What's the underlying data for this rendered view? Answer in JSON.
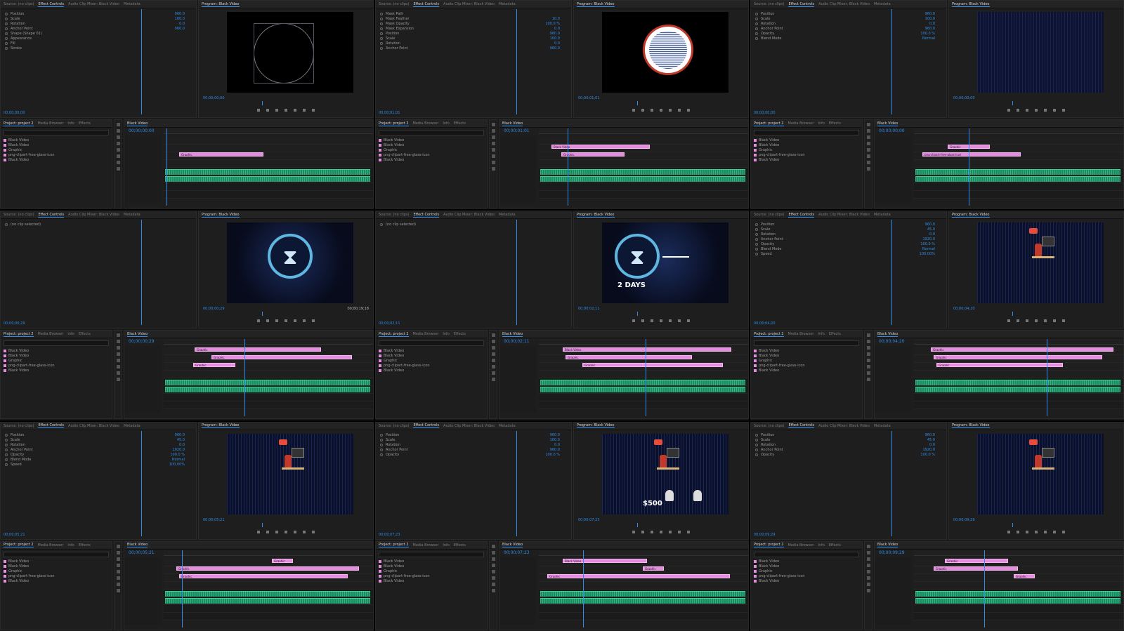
{
  "common": {
    "source_tabs": [
      "Source: (no clips)",
      "Effect Controls",
      "Audio Clip Mixer: Black Video",
      "Metadata"
    ],
    "program_tab": "Program: Black Video",
    "project_tabs": [
      "Project: project 2",
      "Media Browser",
      "Info",
      "Effects"
    ],
    "sequence_tab": "Black Video",
    "search_placeholder": "",
    "project_items": [
      "Black Video",
      "Black Video",
      "Graphic",
      "png-clipart-free-glass-icon",
      "Black Video"
    ]
  },
  "cells": [
    {
      "src_tc": "00;00;00;00",
      "prog_tc": "00;00;00;00",
      "tl_tc": "00;00;00;00",
      "fx_rows": [
        [
          "Position",
          "960.0"
        ],
        [
          "Scale",
          "100.0"
        ],
        [
          "Rotation",
          "0.0"
        ],
        [
          "Anchor Point",
          "960.0"
        ],
        [
          "Shape (Shape 01)",
          ""
        ],
        [
          "Appearance",
          ""
        ],
        [
          "Fill",
          ""
        ],
        [
          "Stroke",
          ""
        ]
      ],
      "clips": [
        "Graphic"
      ]
    },
    {
      "src_tc": "00;00;01;01",
      "prog_tc": "00;00;01;01",
      "tl_tc": "00;00;01;01",
      "fx_rows": [
        [
          "Mask Path",
          ""
        ],
        [
          "Mask Feather",
          "10.0"
        ],
        [
          "Mask Opacity",
          "100.0 %"
        ],
        [
          "Mask Expansion",
          "0.0"
        ],
        [
          "Position",
          "960.0"
        ],
        [
          "Scale",
          "100.0"
        ],
        [
          "Rotation",
          "0.0"
        ],
        [
          "Anchor Point",
          "960.0"
        ]
      ],
      "clips": [
        "Graphic",
        "Black Video"
      ]
    },
    {
      "src_tc": "00;00;00;00",
      "prog_tc": "00;00;00;00",
      "tl_tc": "00;00;00;00",
      "fx_rows": [
        [
          "Position",
          "960.0"
        ],
        [
          "Scale",
          "100.0"
        ],
        [
          "Rotation",
          "0.0"
        ],
        [
          "Anchor Point",
          "960.0"
        ],
        [
          "Opacity",
          "100.0 %"
        ],
        [
          "Blend Mode",
          "Normal"
        ]
      ],
      "clips": [
        "png-clipart-free-glass-icon",
        "Graphic"
      ]
    },
    {
      "src_tc": "00;00;00;29",
      "prog_tc": "00;00;00;29",
      "tl_tc": "00;00;00;29",
      "prog_dur": "00;00;19;18",
      "fx_rows": [
        [
          "(no clip selected)",
          ""
        ]
      ],
      "clips": [
        "Graphic",
        "Graphic",
        "Graphic"
      ]
    },
    {
      "src_tc": "00;00;02;11",
      "prog_tc": "00;00;02;11",
      "tl_tc": "00;00;02;11",
      "fx_rows": [
        [
          "(no clip selected)",
          ""
        ]
      ],
      "clips": [
        "Graphic",
        "Graphic",
        "Black Video"
      ],
      "overlay": "2 DAYS"
    },
    {
      "src_tc": "00;00;04;20",
      "prog_tc": "00;00;04;20",
      "tl_tc": "00;00;04;20",
      "fx_rows": [
        [
          "Position",
          "960.0"
        ],
        [
          "Scale",
          "45.0"
        ],
        [
          "Rotation",
          "0.0"
        ],
        [
          "Anchor Point",
          "1920.0"
        ],
        [
          "Opacity",
          "100.0 %"
        ],
        [
          "Blend Mode",
          "Normal"
        ],
        [
          "Speed",
          "100.00%"
        ]
      ],
      "clips": [
        "Graphic",
        "Graphic",
        "Graphic"
      ]
    },
    {
      "src_tc": "00;00;05;21",
      "prog_tc": "00;00;05;21",
      "tl_tc": "00;00;05;21",
      "fx_rows": [
        [
          "Position",
          "960.0"
        ],
        [
          "Scale",
          "45.0"
        ],
        [
          "Rotation",
          "0.0"
        ],
        [
          "Anchor Point",
          "1920.0"
        ],
        [
          "Opacity",
          "100.0 %"
        ],
        [
          "Blend Mode",
          "Normal"
        ],
        [
          "Speed",
          "100.00%"
        ]
      ],
      "clips": [
        "Graphic",
        "Graphic",
        "Graphic"
      ]
    },
    {
      "src_tc": "00;00;07;23",
      "prog_tc": "00;00;07;23",
      "tl_tc": "00;00;07;23",
      "fx_rows": [
        [
          "Position",
          "960.0"
        ],
        [
          "Scale",
          "100.0"
        ],
        [
          "Rotation",
          "0.0"
        ],
        [
          "Anchor Point",
          "960.0"
        ],
        [
          "Opacity",
          "100.0 %"
        ]
      ],
      "clips": [
        "Graphic",
        "Graphic",
        "Black Video"
      ],
      "overlay": "$500"
    },
    {
      "src_tc": "00;00;09;29",
      "prog_tc": "00;00;09;29",
      "tl_tc": "00;00;09;29",
      "fx_rows": [
        [
          "Position",
          "960.0"
        ],
        [
          "Scale",
          "45.0"
        ],
        [
          "Rotation",
          "0.0"
        ],
        [
          "Anchor Point",
          "1920.0"
        ],
        [
          "Opacity",
          "100.0 %"
        ]
      ],
      "clips": [
        "Graphic",
        "Graphic",
        "Graphic"
      ]
    }
  ],
  "colors": {
    "accent": "#2d8ceb",
    "clip": "#e58ee0",
    "audio": "#1f8a62"
  },
  "icons": [
    "hourglass-icon",
    "person-at-computer-icon",
    "play-icon",
    "step-back-icon",
    "step-forward-icon"
  ]
}
